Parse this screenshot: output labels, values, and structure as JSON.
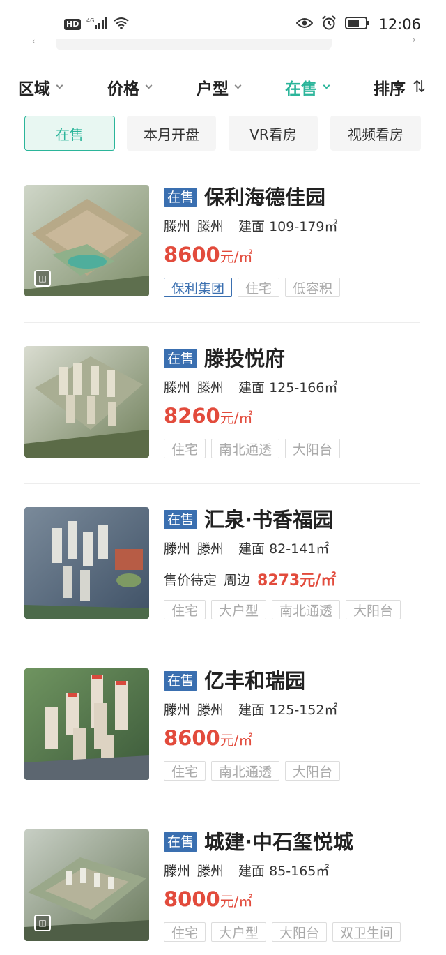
{
  "status_bar": {
    "left_icons": [
      "hd-icon",
      "4g-signal-icon",
      "wifi-icon"
    ],
    "hd_label": "HD",
    "right_icons": [
      "eye-icon",
      "alarm-icon",
      "battery-icon"
    ],
    "time": "12:06"
  },
  "filters": [
    {
      "label": "区域",
      "active": false
    },
    {
      "label": "价格",
      "active": false
    },
    {
      "label": "户型",
      "active": false
    },
    {
      "label": "在售",
      "active": true
    },
    {
      "label": "排序",
      "active": false
    }
  ],
  "chips": [
    {
      "label": "在售",
      "active": true
    },
    {
      "label": "本月开盘",
      "active": false
    },
    {
      "label": "VR看房",
      "active": false
    },
    {
      "label": "视频看房",
      "active": false
    }
  ],
  "colors": {
    "accent_green": "#2bb59a",
    "badge_blue": "#3a6fb0",
    "price_red": "#e24b3c",
    "tag_gray": "#aaaaaa"
  },
  "listings": [
    {
      "status": "在售",
      "name": "保利海德佳园",
      "district": "滕州",
      "area": "滕州",
      "size": "建面 109-179㎡",
      "price": "8600",
      "price_unit": "元/㎡",
      "tags": [
        "保利集团",
        "住宅",
        "低容积"
      ],
      "brand_tag": "保利集团",
      "vr_icon": true
    },
    {
      "status": "在售",
      "name": "滕投悦府",
      "district": "滕州",
      "area": "滕州",
      "size": "建面 125-166㎡",
      "price": "8260",
      "price_unit": "元/㎡",
      "tags": [
        "住宅",
        "南北通透",
        "大阳台"
      ],
      "vr_icon": false
    },
    {
      "status": "在售",
      "name": "汇泉·书香福园",
      "district": "滕州",
      "area": "滕州",
      "size": "建面 82-141㎡",
      "price_pending": "售价待定",
      "nearby_label": "周边",
      "nearby_price": "8273元/㎡",
      "tags": [
        "住宅",
        "大户型",
        "南北通透",
        "大阳台"
      ],
      "vr_icon": false
    },
    {
      "status": "在售",
      "name": "亿丰和瑞园",
      "district": "滕州",
      "area": "滕州",
      "size": "建面 125-152㎡",
      "price": "8600",
      "price_unit": "元/㎡",
      "tags": [
        "住宅",
        "南北通透",
        "大阳台"
      ],
      "vr_icon": false
    },
    {
      "status": "在售",
      "name": "城建·中石玺悦城",
      "district": "滕州",
      "area": "滕州",
      "size": "建面 85-165㎡",
      "price": "8000",
      "price_unit": "元/㎡",
      "tags": [
        "住宅",
        "大户型",
        "大阳台",
        "双卫生间"
      ],
      "vr_icon": true
    }
  ]
}
